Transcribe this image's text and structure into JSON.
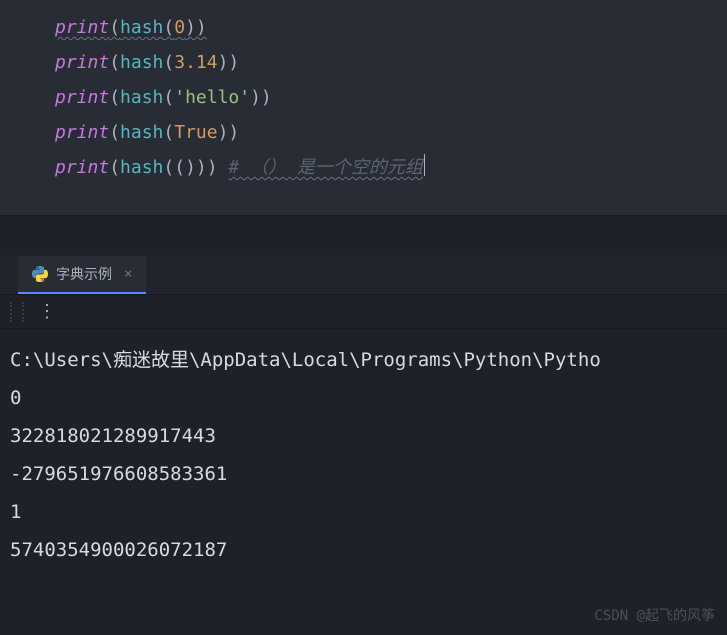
{
  "code": {
    "lines": [
      {
        "tokens": [
          {
            "cls": "t-func underline",
            "txt": "print"
          },
          {
            "cls": "t-paren underline",
            "txt": "("
          },
          {
            "cls": "t-builtin underline",
            "txt": "hash"
          },
          {
            "cls": "t-paren underline",
            "txt": "("
          },
          {
            "cls": "t-num underline",
            "txt": "0"
          },
          {
            "cls": "t-paren underline",
            "txt": "))"
          }
        ]
      },
      {
        "tokens": [
          {
            "cls": "t-func",
            "txt": "print"
          },
          {
            "cls": "t-paren",
            "txt": "("
          },
          {
            "cls": "t-builtin",
            "txt": "hash"
          },
          {
            "cls": "t-paren",
            "txt": "("
          },
          {
            "cls": "t-num",
            "txt": "3.14"
          },
          {
            "cls": "t-paren",
            "txt": "))"
          }
        ]
      },
      {
        "tokens": [
          {
            "cls": "t-func",
            "txt": "print"
          },
          {
            "cls": "t-paren",
            "txt": "("
          },
          {
            "cls": "t-builtin",
            "txt": "hash"
          },
          {
            "cls": "t-paren",
            "txt": "("
          },
          {
            "cls": "t-str",
            "txt": "'hello'"
          },
          {
            "cls": "t-paren",
            "txt": "))"
          }
        ]
      },
      {
        "tokens": [
          {
            "cls": "t-func",
            "txt": "print"
          },
          {
            "cls": "t-paren",
            "txt": "("
          },
          {
            "cls": "t-builtin",
            "txt": "hash"
          },
          {
            "cls": "t-paren",
            "txt": "("
          },
          {
            "cls": "t-bool",
            "txt": "True"
          },
          {
            "cls": "t-paren",
            "txt": "))"
          }
        ]
      },
      {
        "tokens": [
          {
            "cls": "t-func",
            "txt": "print"
          },
          {
            "cls": "t-paren",
            "txt": "("
          },
          {
            "cls": "t-builtin",
            "txt": "hash"
          },
          {
            "cls": "t-paren",
            "txt": "(()))"
          },
          {
            "cls": "",
            "txt": " "
          },
          {
            "cls": "t-comment underline",
            "txt": "# （） 是一个空的元组"
          }
        ],
        "cursor": true
      }
    ]
  },
  "tab": {
    "label": "字典示例",
    "close": "×"
  },
  "toolbar": {
    "more": "⋮"
  },
  "console": {
    "lines": [
      "C:\\Users\\痴迷故里\\AppData\\Local\\Programs\\Python\\Pytho",
      "0",
      "322818021289917443",
      "-279651976608583361",
      "1",
      "5740354900026072187"
    ]
  },
  "watermark": "CSDN @起飞的风筝"
}
